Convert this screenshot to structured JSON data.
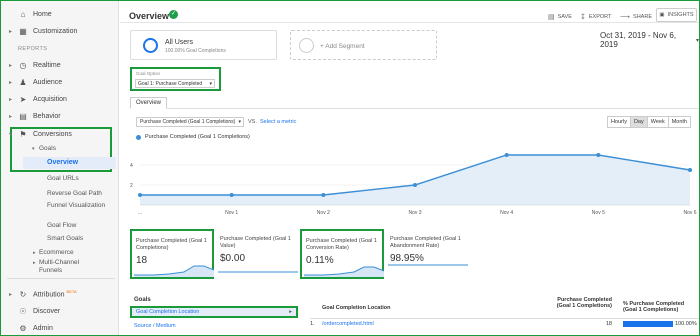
{
  "sidebar": {
    "home": "Home",
    "customization": "Customization",
    "reports_header": "REPORTS",
    "realtime": "Realtime",
    "audience": "Audience",
    "acquisition": "Acquisition",
    "behavior": "Behavior",
    "conversions": "Conversions",
    "goals": "Goals",
    "overview": "Overview",
    "goal_urls": "Goal URLs",
    "reverse_goal_path": "Reverse Goal Path",
    "funnel_visualization": "Funnel Visualization",
    "goal_flow": "Goal Flow",
    "smart_goals": "Smart Goals",
    "ecommerce": "Ecommerce",
    "multi_channel_funnels": "Multi-Channel Funnels",
    "attribution": "Attribution",
    "attribution_badge": "BETA",
    "discover": "Discover",
    "admin": "Admin"
  },
  "header": {
    "title": "Overview",
    "save": "SAVE",
    "export": "EXPORT",
    "share": "SHARE",
    "insights": "INSIGHTS"
  },
  "segment": {
    "name": "All Users",
    "sub": "100.00% Goal Completions",
    "add": "+ Add Segment"
  },
  "date_range": "Oct 31, 2019 - Nov 6, 2019",
  "goal_option": {
    "caption": "Goal Option",
    "value": "Goal 1: Purchase Completed"
  },
  "tabs": [
    "Overview"
  ],
  "chart_controls": {
    "metric": "Purchase Completed (Goal 1 Completions)",
    "vs": "VS.",
    "select_metric": "Select a metric",
    "granularity": [
      "Hourly",
      "Day",
      "Week",
      "Month"
    ],
    "active_granularity": "Day"
  },
  "chart_data": {
    "type": "area",
    "series": [
      {
        "name": "Purchase Completed (Goal 1 Completions)",
        "values": [
          1,
          1,
          1,
          2,
          5,
          5,
          3.5
        ]
      }
    ],
    "categories": [
      "...",
      "Nov 1",
      "Nov 2",
      "Nov 3",
      "Nov 4",
      "Nov 5",
      "Nov 6"
    ],
    "yticks": [
      2,
      4
    ],
    "ylim": [
      0,
      6
    ],
    "color": "#3a8fd6"
  },
  "scorecards": [
    {
      "title": "Purchase Completed (Goal 1 Completions)",
      "value": "18"
    },
    {
      "title": "Purchase Completed (Goal 1 Value)",
      "value": "$0.00"
    },
    {
      "title": "Purchase Completed (Goal 1 Conversion Rate)",
      "value": "0.11%"
    },
    {
      "title": "Purchase Completed (Goal 1 Abandonment Rate)",
      "value": "98.95%"
    }
  ],
  "goals_panel": {
    "header": "Goals",
    "selected": "Goal Completion Location",
    "source_medium": "Source / Medium"
  },
  "table": {
    "col1": "Goal Completion Location",
    "col2": "Purchase Completed (Goal 1 Completions)",
    "col3": "% Purchase Completed (Goal 1 Completions)",
    "rows": [
      {
        "num": "1.",
        "location": "/ordercompleted.html",
        "completions": "18",
        "pct": "100.00%",
        "pct_value": 100
      }
    ]
  }
}
